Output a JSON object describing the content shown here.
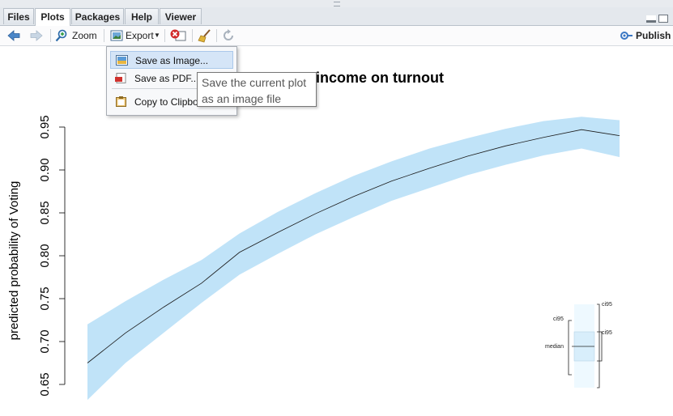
{
  "tabs": [
    {
      "label": "Files"
    },
    {
      "label": "Plots"
    },
    {
      "label": "Packages"
    },
    {
      "label": "Help"
    },
    {
      "label": "Viewer"
    }
  ],
  "toolbar": {
    "zoom_label": "Zoom",
    "export_label": "Export",
    "publish_label": "Publish"
  },
  "export_menu": {
    "items": [
      {
        "label": "Save as Image...",
        "icon": "image-icon"
      },
      {
        "label": "Save as PDF...",
        "icon": "pdf-icon"
      },
      {
        "label": "Copy to Clipbo",
        "icon": "clipboard-icon"
      }
    ]
  },
  "tooltip": {
    "line1": "Save the current plot",
    "line2": "as an image file"
  },
  "chart_data": {
    "type": "line",
    "title_visible": "income on turnout",
    "ylabel": "predicted probability of Voting",
    "ylim": [
      0.65,
      0.95
    ],
    "yticks": [
      "0.65",
      "0.70",
      "0.75",
      "0.80",
      "0.85",
      "0.90",
      "0.95"
    ],
    "x": [
      0,
      1,
      2,
      3,
      4,
      5,
      6,
      7,
      8,
      9,
      10,
      11,
      12,
      13,
      14
    ],
    "median": [
      0.675,
      0.71,
      0.74,
      0.768,
      0.804,
      0.827,
      0.849,
      0.869,
      0.887,
      0.902,
      0.916,
      0.928,
      0.938,
      0.947,
      0.94
    ],
    "lower": [
      0.632,
      0.675,
      0.71,
      0.745,
      0.778,
      0.802,
      0.825,
      0.845,
      0.864,
      0.879,
      0.894,
      0.906,
      0.917,
      0.925,
      0.915
    ],
    "upper": [
      0.72,
      0.747,
      0.772,
      0.795,
      0.826,
      0.851,
      0.873,
      0.893,
      0.91,
      0.925,
      0.937,
      0.948,
      0.957,
      0.962,
      0.958
    ],
    "band_color": "#c0e3f8",
    "line_color": "#1a1a1a",
    "legend": {
      "ci95_left": "ci95",
      "ci95_right": "ci95",
      "ci50_right": "ci95",
      "median": "median"
    }
  }
}
